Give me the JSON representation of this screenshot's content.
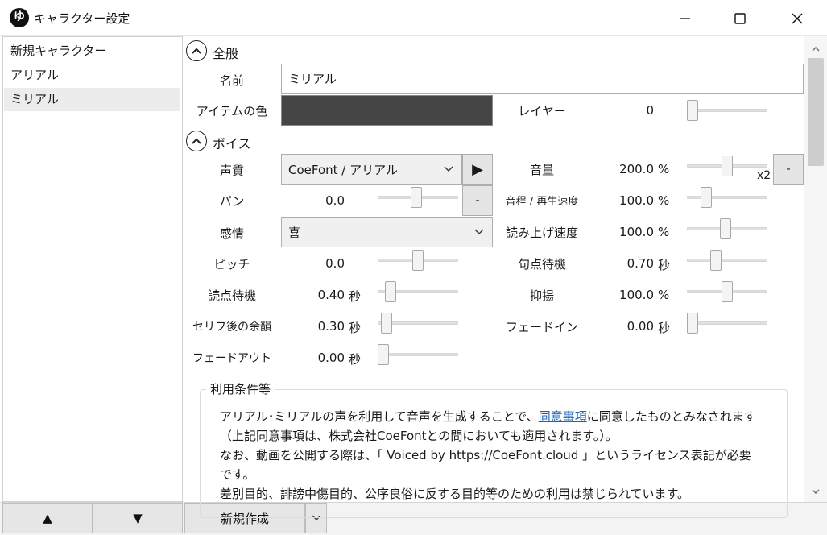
{
  "window": {
    "title": "キャラクター設定",
    "app_icon_text": "ゆ"
  },
  "characters": [
    {
      "name": "新規キャラクター",
      "selected": false
    },
    {
      "name": "アリアル",
      "selected": false
    },
    {
      "name": "ミリアル",
      "selected": true
    }
  ],
  "bottom": {
    "up_label": "▲",
    "down_label": "▼",
    "new_label": "新規作成"
  },
  "general": {
    "section_title": "全般",
    "name_label": "名前",
    "name_value": "ミリアル",
    "item_color_label": "アイテムの色",
    "item_color": "#454545",
    "layer_label": "レイヤー",
    "layer_value": "0",
    "layer_level": 0.0
  },
  "voice": {
    "section_title": "ボイス",
    "quality_label": "声質",
    "quality_value": "CoeFont / アリアル",
    "play_label": "▶",
    "emotion_label": "感情",
    "emotion_value": "喜",
    "volume_btn_label": "-",
    "pan_btn_label": "-",
    "volume_multiplier": "x2",
    "left_params": [
      {
        "key": "pan",
        "label": "パン",
        "value": "0.0",
        "unit": "",
        "level": 0.48
      },
      {
        "key": "pitch",
        "label": "ピッチ",
        "value": "0.0",
        "unit": "",
        "level": 0.5
      },
      {
        "key": "comma_wait",
        "label": "読点待機",
        "value": "0.40",
        "unit": "秒",
        "level": 0.1
      },
      {
        "key": "after_serif",
        "label": "セリフ後の余韻",
        "value": "0.30",
        "unit": "秒",
        "level": 0.05
      },
      {
        "key": "fade_out",
        "label": "フェードアウト",
        "value": "0.00",
        "unit": "秒",
        "level": 0.0
      }
    ],
    "right_params": [
      {
        "key": "volume",
        "label": "音量",
        "value": "200.0",
        "unit": "%",
        "level": 0.5
      },
      {
        "key": "pitch_speed",
        "label": "音程 / 再生速度",
        "value": "100.0",
        "unit": "%",
        "level": 0.2
      },
      {
        "key": "read_speed",
        "label": "読み上げ速度",
        "value": "100.0",
        "unit": "%",
        "level": 0.48
      },
      {
        "key": "period_wait",
        "label": "句点待機",
        "value": "0.70",
        "unit": "秒",
        "level": 0.34
      },
      {
        "key": "intonation",
        "label": "抑揚",
        "value": "100.0",
        "unit": "%",
        "level": 0.5
      },
      {
        "key": "fade_in",
        "label": "フェードイン",
        "value": "0.00",
        "unit": "秒",
        "level": 0.0
      }
    ]
  },
  "terms": {
    "title": "利用条件等",
    "line1_pre": "アリアル･ミリアルの声を利用して音声を生成することで、",
    "line1_link": "同意事項",
    "line1_post": "に同意したものとみなされます",
    "line2": "（上記同意事項は、株式会社CoeFontとの間においても適用されます。）。",
    "line3": "なお、動画を公開する際は、「 Voiced by https://CoeFont.cloud 」というライセンス表記が必要",
    "line4": "です。",
    "line5": "差別目的、誹謗中傷目的、公序良俗に反する目的等のための利用は禁じられています。"
  }
}
